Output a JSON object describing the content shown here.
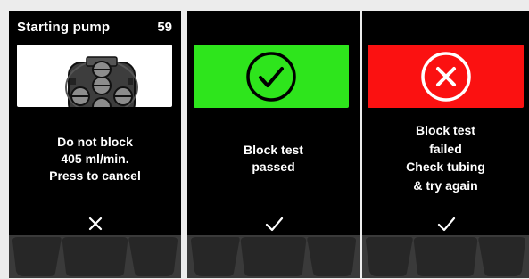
{
  "screens": [
    {
      "id": "starting-pump",
      "header": {
        "title": "Starting pump",
        "counter": "59"
      },
      "image_icon": "pump-head-icon",
      "message_lines": [
        "Do not block",
        "405 ml/min.",
        "Press to cancel"
      ],
      "action_icon": "close-icon"
    },
    {
      "id": "block-test-passed",
      "status_color": "#2ee51c",
      "status_icon": "check-circle-icon",
      "message_lines": [
        "Block test",
        "passed"
      ],
      "action_icon": "check-icon"
    },
    {
      "id": "block-test-failed",
      "status_color": "#fb1111",
      "status_icon": "x-circle-icon",
      "message_lines": [
        "Block test",
        "failed",
        "Check tubing",
        "& try again"
      ],
      "action_icon": "check-icon"
    }
  ],
  "colors": {
    "panel_background": "#000000",
    "softkey_base": "#3a3a3a",
    "softkey_button": "#272727",
    "page_background": "#ececec"
  }
}
